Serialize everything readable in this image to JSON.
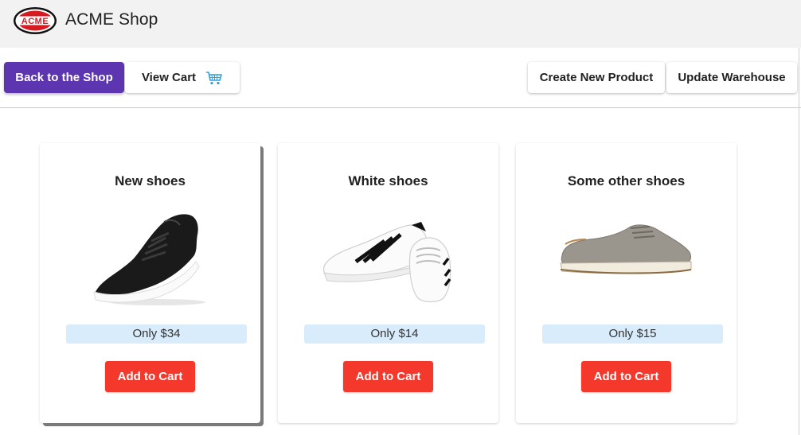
{
  "header": {
    "logo_text": "ACME",
    "title": "ACME Shop"
  },
  "toolbar": {
    "back_label": "Back to the Shop",
    "view_cart_label": "View Cart",
    "cart_icon": "shopping-cart-icon",
    "create_label": "Create New Product",
    "update_label": "Update Warehouse"
  },
  "products": [
    {
      "name": "New shoes",
      "price": "Only $34",
      "button": "Add to Cart",
      "image": "black-sneaker-image"
    },
    {
      "name": "White shoes",
      "price": "Only $14",
      "button": "Add to Cart",
      "image": "white-sneakers-image"
    },
    {
      "name": "Some other shoes",
      "price": "Only $15",
      "button": "Add to Cart",
      "image": "grey-shoe-image"
    }
  ],
  "colors": {
    "primary": "#5e35b1",
    "add_to_cart": "#f4392c",
    "price_bg": "#d8ecfb",
    "cart_icon": "#29a3e0",
    "logo_red": "#d71920"
  }
}
